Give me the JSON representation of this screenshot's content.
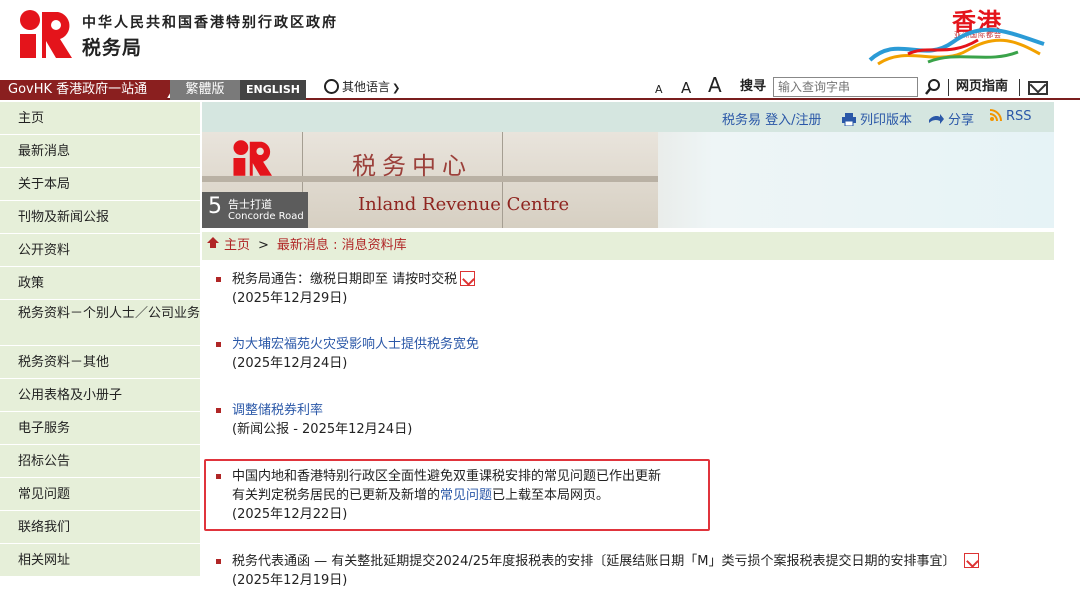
{
  "header": {
    "gov_name": "中华人民共和国香港特别行政区政府",
    "dept_name": "税务局",
    "brand_title": "香港",
    "brand_sub": "亚洲国际都会"
  },
  "topnav": {
    "govhk": "GovHK 香港政府一站通",
    "trad": "繁體版",
    "english": "ENGLISH",
    "other_lang": "其他语言",
    "font_small": "A",
    "font_mid": "A",
    "font_large": "A",
    "search_label": "搜寻",
    "search_placeholder": "输入查询字串",
    "sitemap": "网页指南"
  },
  "sidebar": {
    "items": [
      {
        "label": "主页"
      },
      {
        "label": "最新消息"
      },
      {
        "label": "关于本局"
      },
      {
        "label": "刊物及新闻公报"
      },
      {
        "label": "公开资料"
      },
      {
        "label": "政策"
      },
      {
        "label": "税务资料－个别人士／公司业务"
      },
      {
        "label": "税务资料－其他"
      },
      {
        "label": "公用表格及小册子"
      },
      {
        "label": "电子服务"
      },
      {
        "label": "招标公告"
      },
      {
        "label": "常见问题"
      },
      {
        "label": "联络我们"
      },
      {
        "label": "相关网址"
      }
    ]
  },
  "utility": {
    "etax": "税务易 登入/注册",
    "print": "列印版本",
    "share": "分享",
    "rss": "RSS"
  },
  "banner": {
    "hanzi": "税务中心",
    "english": "Inland Revenue Centre",
    "road_num": "5",
    "road_zh": "告士打道",
    "road_en": "Concorde Road"
  },
  "breadcrumb": {
    "home": "主页",
    "sep": ">",
    "latest": "最新消息",
    "current": "消息资料库"
  },
  "news": [
    {
      "title": "税务局通告：缴税日期即至 请按时交税",
      "date": "(2025年12月29日)"
    },
    {
      "title": "为大埔宏福苑火灾受影响人士提供税务宽免",
      "date": "(2025年12月24日)"
    },
    {
      "title": "调整储税券利率",
      "date": "(新闻公报 - 2025年12月24日)"
    },
    {
      "title": "中国内地和香港特别行政区全面性避免双重课税安排的常见问题已作出更新",
      "line2_pre": "有关判定税务居民的已更新及新增的",
      "line2_link": "常见问题",
      "line2_post": "已上载至本局网页。",
      "date": "(2025年12月22日)"
    },
    {
      "title": "税务代表通函 — 有关整批延期提交2024/25年度报税表的安排〔延展结账日期「M」类亏损个案报税表提交日期的安排事宜〕",
      "date": "(2025年12月19日)"
    }
  ],
  "colors": {
    "accent_red": "#b02626",
    "link_blue": "#2b58a8",
    "sidebar_green": "#e6efd9",
    "utility_teal": "#d5e6e0",
    "highlight_red": "#e0343c"
  }
}
